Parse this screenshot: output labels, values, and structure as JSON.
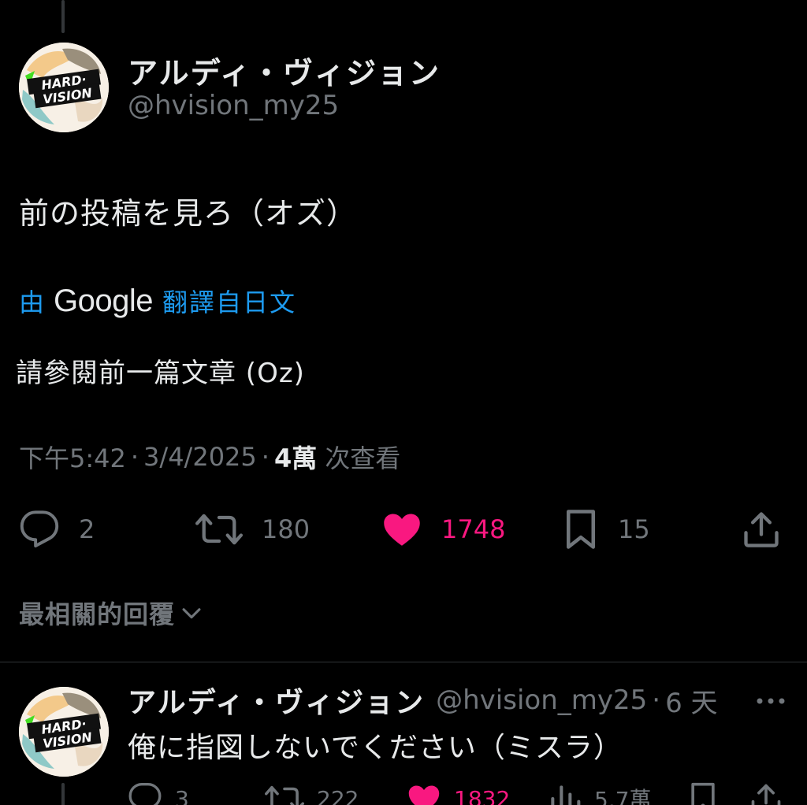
{
  "main_tweet": {
    "author": {
      "display_name": "アルディ・ヴィジョン",
      "handle": "@hvision_my25"
    },
    "text": "前の投稿を見ろ（オズ）",
    "translation": {
      "by_label": "由",
      "provider": "Google",
      "from_label": "翻譯自日文",
      "text": "請參閱前一篇文章 (Oz)"
    },
    "meta": {
      "time": "下午5:42",
      "date": "3/4/2025",
      "views_count": "4萬",
      "views_label": "次查看",
      "separator": "·"
    },
    "actions": {
      "replies": "2",
      "retweets": "180",
      "likes": "1748",
      "bookmarks": "15"
    }
  },
  "sort": {
    "label": "最相關的回覆"
  },
  "reply": {
    "author": {
      "display_name": "アルディ・ヴィジョン",
      "handle": "@hvision_my25"
    },
    "separator": "·",
    "time": "6 天",
    "text": "俺に指図しないでください（ミスラ）",
    "actions": {
      "replies": "3",
      "retweets": "222",
      "likes": "1832",
      "views": "5.7萬"
    }
  },
  "colors": {
    "background": "#000000",
    "text_primary": "#e7e9ea",
    "text_secondary": "#71767b",
    "link_blue": "#1d9bf0",
    "like_pink": "#f91880",
    "divider": "#2f3336"
  }
}
